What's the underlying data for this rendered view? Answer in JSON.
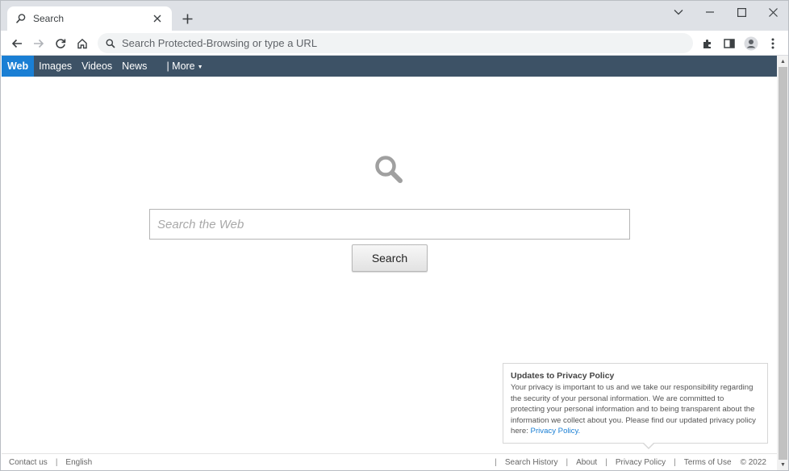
{
  "browser": {
    "tab_title": "Search",
    "omnibox_placeholder": "Search Protected-Browsing or type a URL"
  },
  "nav": {
    "items": [
      {
        "label": "Web",
        "active": true
      },
      {
        "label": "Images",
        "active": false
      },
      {
        "label": "Videos",
        "active": false
      },
      {
        "label": "News",
        "active": false
      }
    ],
    "more_label": "| More",
    "more_caret": "▼"
  },
  "search": {
    "placeholder": "Search the Web",
    "button_label": "Search"
  },
  "privacy": {
    "title": "Updates to Privacy Policy",
    "body": "Your privacy is important to us and we take our responsibility regarding the security of your personal information. We are committed to protecting your personal information and to being transparent about the information we collect about you. Please find our updated privacy policy here:",
    "link_label": "Privacy Policy",
    "link_suffix": "."
  },
  "footer": {
    "left": [
      "Contact us",
      "English"
    ],
    "right": [
      "Search History",
      "About",
      "Privacy Policy",
      "Terms of Use"
    ],
    "copyright": "© 2022",
    "separator": "|"
  },
  "colors": {
    "nav_bar": "#3d5266",
    "nav_active": "#1a7fd4",
    "link": "#1a7fd4"
  },
  "icons": [
    "search-icon",
    "close-icon",
    "plus-icon",
    "back-icon",
    "forward-icon",
    "reload-icon",
    "home-icon",
    "extensions-icon",
    "side-panel-icon",
    "profile-icon",
    "menu-icon",
    "minimize-icon",
    "maximize-icon",
    "chevron-down-icon",
    "magnifier-icon"
  ]
}
